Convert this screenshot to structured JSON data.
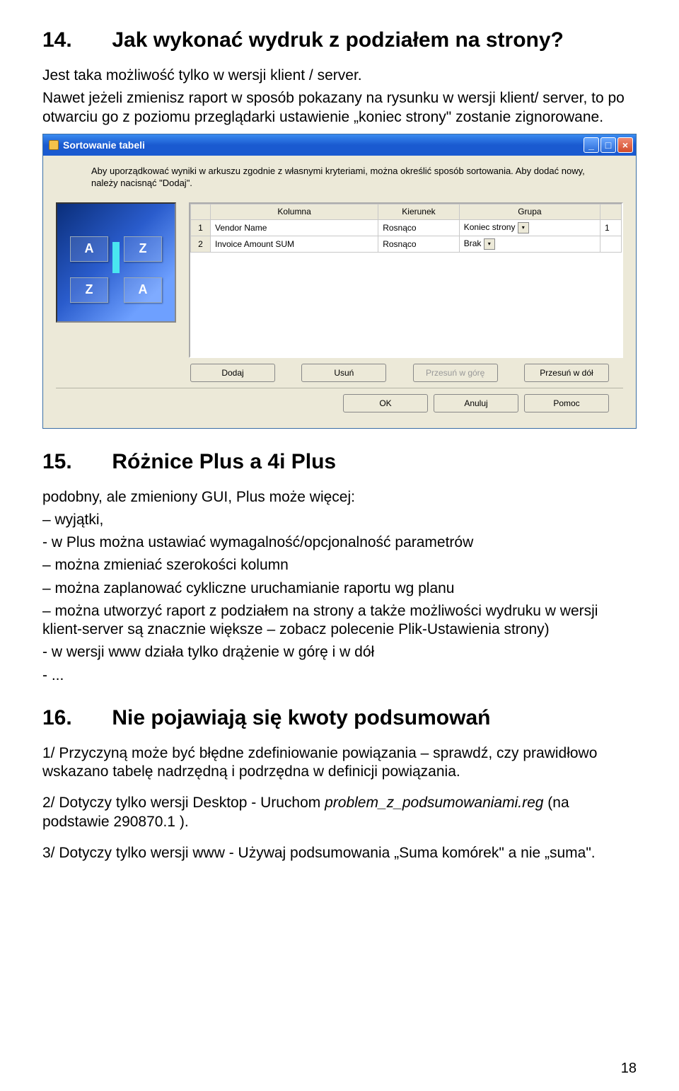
{
  "sections": {
    "s14": {
      "num": "14.",
      "title": "Jak wykonać wydruk z podziałem na strony?"
    },
    "s15": {
      "num": "15.",
      "title": "Różnice Plus a 4i Plus"
    },
    "s16": {
      "num": "16.",
      "title": "Nie pojawiają się kwoty podsumowań"
    }
  },
  "p14a": "Jest taka możliwość tylko w wersji klient / server.",
  "p14b": "Nawet jeżeli zmienisz raport w sposób pokazany na rysunku w wersji klient/ server, to po otwarciu go z poziomu przeglądarki ustawienie „koniec strony\" zostanie zignorowane.",
  "dlg": {
    "title": "Sortowanie tabeli",
    "desc": "Aby uporządkować wyniki w arkuszu zgodnie z własnymi kryteriami, można określić sposób sortowania. Aby dodać nowy, należy nacisnąć \"Dodaj\".",
    "headers": {
      "blank": "",
      "col": "Kolumna",
      "dir": "Kierunek",
      "grp": "Grupa",
      "end": ""
    },
    "rows": [
      {
        "n": "1",
        "col": "Vendor Name",
        "dir": "Rosnąco",
        "grp": "Koniec strony",
        "end": "1"
      },
      {
        "n": "2",
        "col": "Invoice Amount SUM",
        "dir": "Rosnąco",
        "grp": "Brak",
        "end": ""
      }
    ],
    "buttons": {
      "add": "Dodaj",
      "del": "Usuń",
      "up": "Przesuń w górę",
      "down": "Przesuń w dół",
      "ok": "OK",
      "cancel": "Anuluj",
      "help": "Pomoc"
    },
    "illus": {
      "a": "A",
      "z": "Z"
    }
  },
  "p15a": "podobny, ale zmieniony GUI, Plus może więcej:",
  "p15list": [
    "– wyjątki,",
    "- w Plus można ustawiać wymagalność/opcjonalność parametrów",
    "– można zmieniać szerokości kolumn",
    "– można zaplanować cykliczne uruchamianie raportu wg planu",
    "– można utworzyć raport z podziałem na strony a także  możliwości wydruku w wersji klient-server są znacznie większe – zobacz polecenie Plik-Ustawienia strony)",
    "- w wersji www działa tylko drążenie w górę i w dół",
    "- ..."
  ],
  "p16a": "1/ Przyczyną może być błędne zdefiniowanie powiązania – sprawdź, czy prawidłowo wskazano tabelę nadrzędną i podrzędna w definicji powiązania.",
  "p16b_pre": "2/ Dotyczy tylko wersji Desktop - Uruchom ",
  "p16b_file": "problem_z_podsumowaniami.reg",
  "p16b_post": " (na podstawie 290870.1 ).",
  "p16c": "3/ Dotyczy tylko wersji www - Używaj podsumowania „Suma komórek\" a nie „suma\".",
  "pagenum": "18"
}
